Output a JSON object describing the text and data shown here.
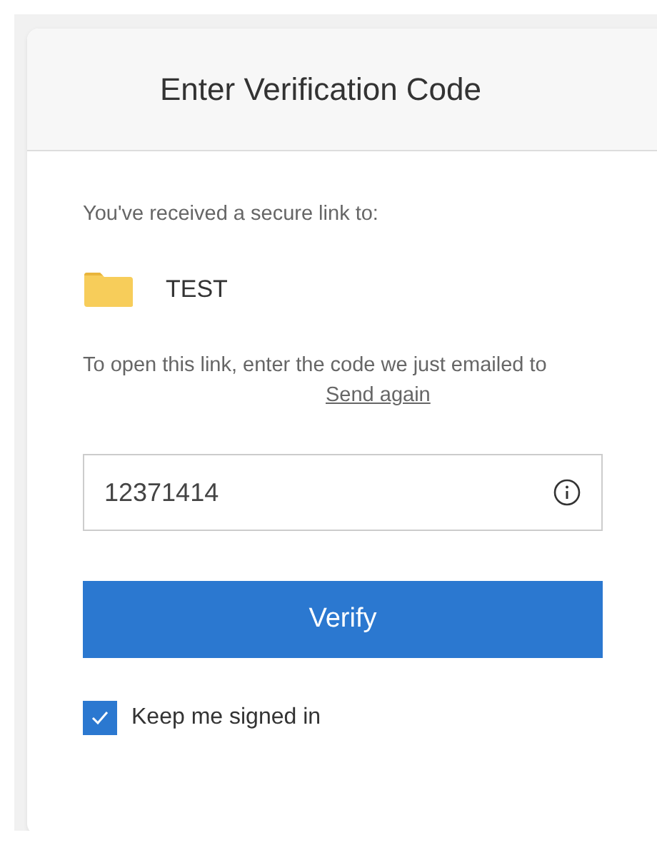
{
  "header": {
    "title": "Enter Verification Code"
  },
  "intro": "You've received a secure link to:",
  "item": {
    "name": "TEST"
  },
  "instructions": {
    "text": "To open this link, enter the code we just emailed to",
    "link": "Send again"
  },
  "code_field": {
    "value": "12371414"
  },
  "verify_button": {
    "label": "Verify"
  },
  "keep_signed_in": {
    "label": "Keep me signed in",
    "checked": true
  }
}
